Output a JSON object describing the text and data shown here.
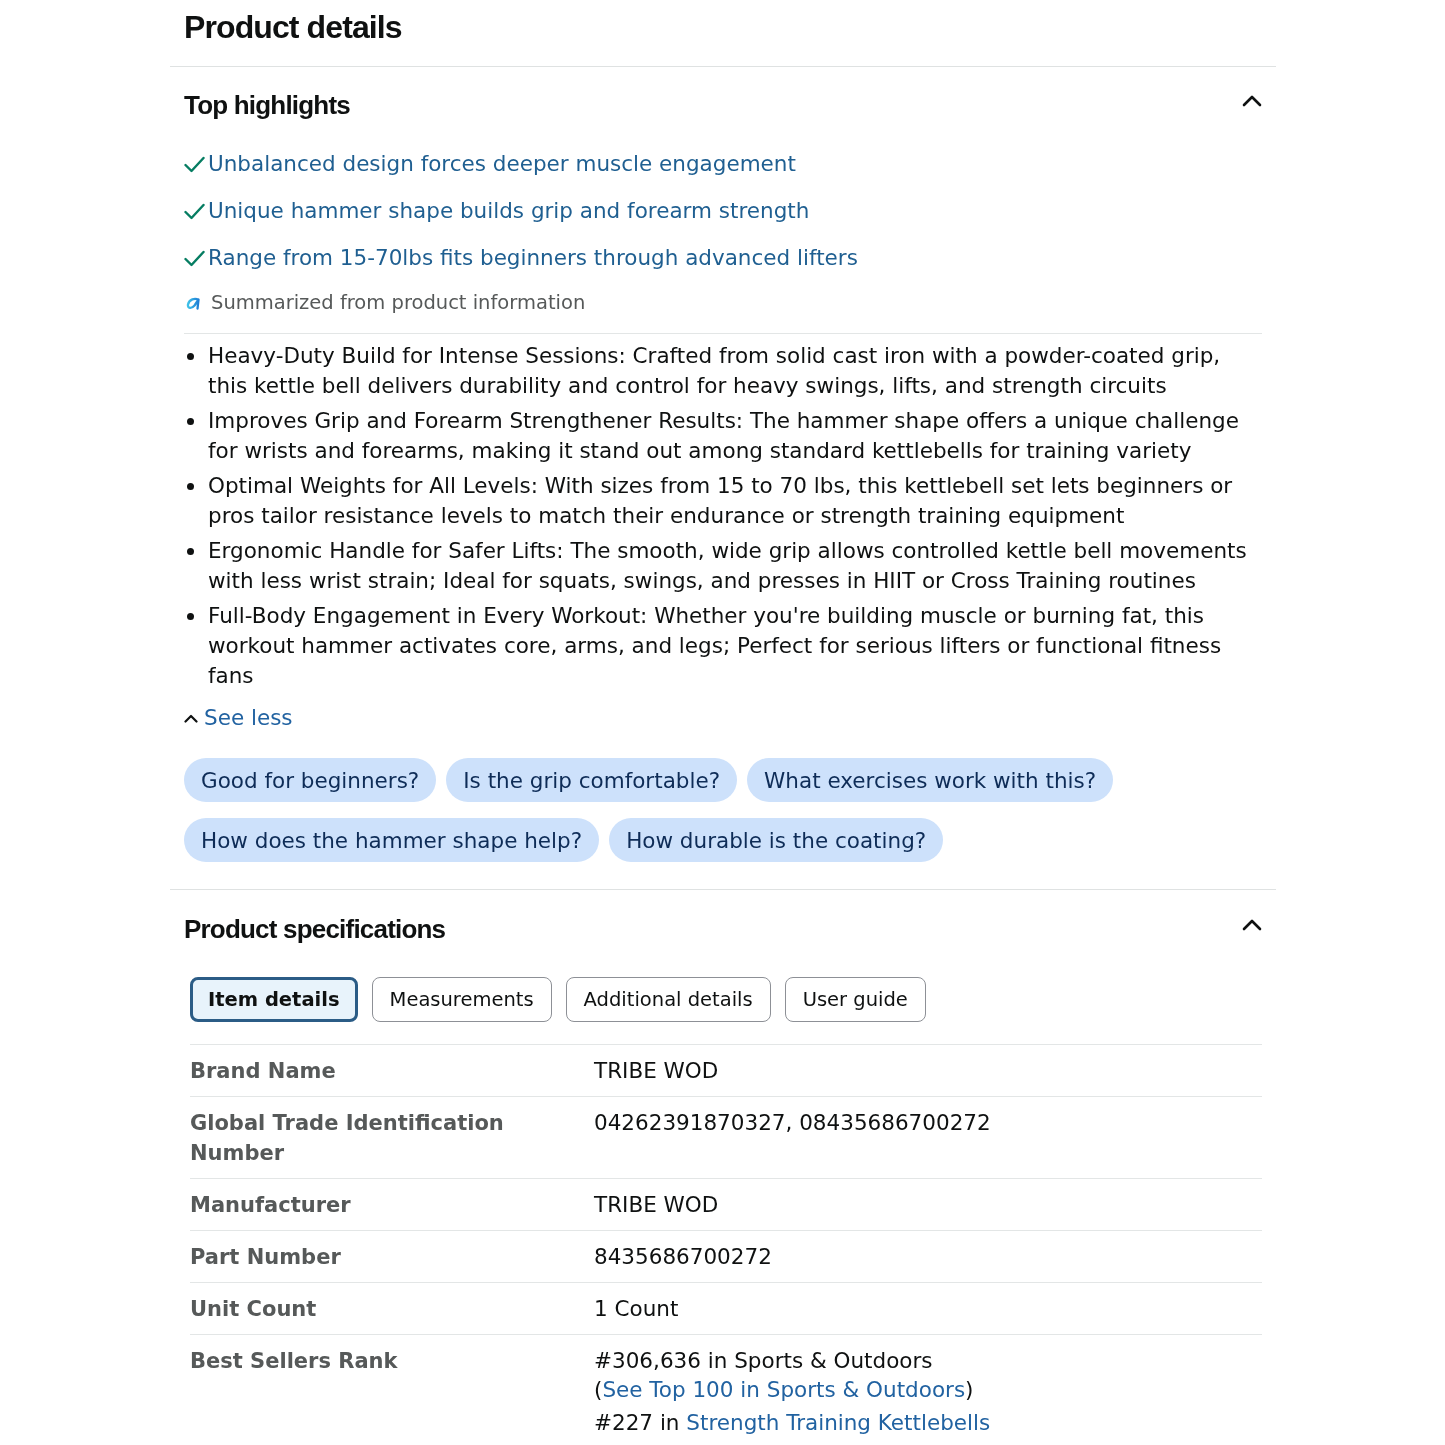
{
  "page": {
    "title": "Product details"
  },
  "top_highlights": {
    "title": "Top highlights",
    "expanded": true,
    "highlights": [
      "Unbalanced design forces deeper muscle engagement",
      "Unique hammer shape builds grip and forearm strength",
      "Range from 15-70lbs fits beginners through advanced lifters"
    ],
    "summary_note": "Summarized from product information",
    "bullets": [
      "Heavy-Duty Build for Intense Sessions: Crafted from solid cast iron with a powder-coated grip, this kettle bell delivers durability and control for heavy swings, lifts, and strength circuits",
      "Improves Grip and Forearm Strengthener Results: The hammer shape offers a unique challenge for wrists and forearms, making it stand out among standard kettlebells for training variety",
      "Optimal Weights for All Levels: With sizes from 15 to 70 lbs, this kettlebell set lets beginners or pros tailor resistance levels to match their endurance or strength training equipment",
      "Ergonomic Handle for Safer Lifts: The smooth, wide grip allows controlled kettle bell movements with less wrist strain; Ideal for squats, swings, and presses in HIIT or Cross Training routines",
      "Full-Body Engagement in Every Workout: Whether you're building muscle or burning fat, this workout hammer activates core, arms, and legs; Perfect for serious lifters or functional fitness fans"
    ],
    "toggle": "See less",
    "questions": [
      "Good for beginners?",
      "Is the grip comfortable?",
      "What exercises work with this?",
      "How does the hammer shape help?",
      "How durable is the coating?"
    ]
  },
  "product_specifications": {
    "title": "Product specifications",
    "expanded": true,
    "tabs": [
      {
        "label": "Item details",
        "selected": true
      },
      {
        "label": "Measurements",
        "selected": false
      },
      {
        "label": "Additional details",
        "selected": false
      },
      {
        "label": "User guide",
        "selected": false
      }
    ],
    "rows": [
      {
        "label": "Brand Name",
        "value": "TRIBE WOD"
      },
      {
        "label": "Global Trade Identification Number",
        "value": "04262391870327, 08435686700272"
      },
      {
        "label": "Manufacturer",
        "value": "TRIBE WOD"
      },
      {
        "label": "Part Number",
        "value": "8435686700272"
      },
      {
        "label": "Unit Count",
        "value": "1 Count"
      },
      {
        "label": "Best Sellers Rank",
        "value_lines": [
          {
            "text": "#306,636 in Sports & Outdoors (",
            "link": "See Top 100 in Sports & Outdoors",
            "after": ")"
          },
          {
            "text": "#227 in ",
            "link": "Strength Training Kettlebells"
          }
        ]
      }
    ]
  }
}
